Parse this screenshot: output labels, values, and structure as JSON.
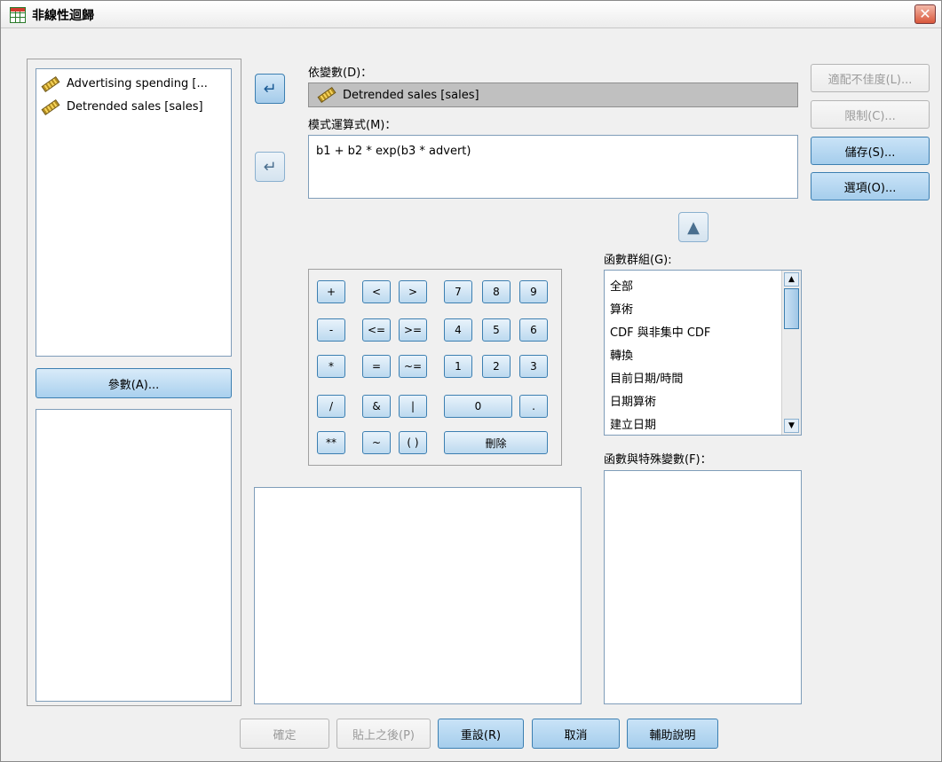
{
  "window": {
    "title": "非線性迴歸",
    "close_glyph": "✕"
  },
  "variables_list": [
    {
      "label": "Advertising spending [...",
      "icon": "scale-ruler-icon"
    },
    {
      "label": "Detrended sales [sales]",
      "icon": "scale-ruler-icon"
    }
  ],
  "dependent": {
    "label": "依變數(D)：",
    "value": "Detrended sales [sales]"
  },
  "model": {
    "label": "模式運算式(M)：",
    "value": "b1 + b2 * exp(b3 * advert)"
  },
  "params_button": "參數(A)...",
  "right_buttons": {
    "fit": "適配不佳度(L)...",
    "constraints": "限制(C)...",
    "save": "儲存(S)...",
    "options": "選項(O)..."
  },
  "function_group": {
    "label": "函數群組(G):",
    "items": [
      "全部",
      "算術",
      "CDF 與非集中 CDF",
      "轉換",
      "目前日期/時間",
      "日期算術",
      "建立日期"
    ]
  },
  "functions_label": "函數與特殊變數(F)：",
  "calculator": {
    "row1": [
      "+",
      "<",
      ">",
      "7",
      "8",
      "9"
    ],
    "row2": [
      "-",
      "<=",
      ">=",
      "4",
      "5",
      "6"
    ],
    "row3": [
      "*",
      "=",
      "~=",
      "1",
      "2",
      "3"
    ],
    "row4": [
      "/",
      "&",
      "|",
      "0",
      "."
    ],
    "row5": [
      "**",
      "~",
      "( )",
      "刪除"
    ]
  },
  "footer": {
    "ok": "確定",
    "paste": "貼上之後(P)",
    "reset": "重設(R)",
    "cancel": "取消",
    "help": "輔助說明"
  },
  "colors": {
    "accent": "#3c7fb1",
    "dependent_bg": "#c0c0c0"
  }
}
